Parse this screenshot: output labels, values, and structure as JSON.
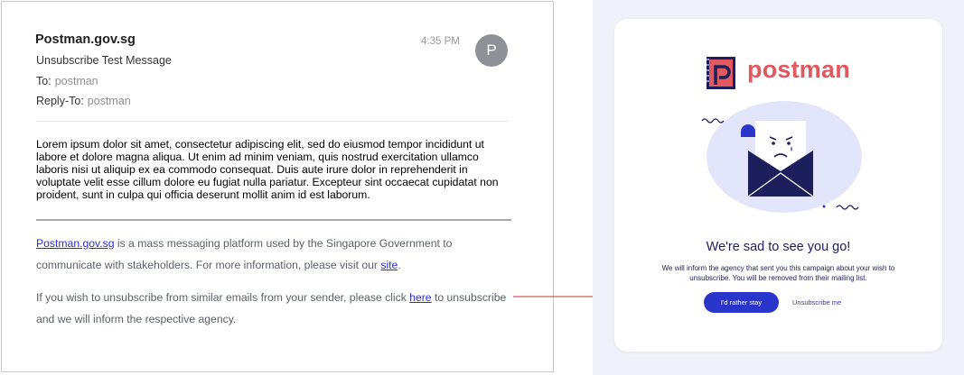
{
  "email": {
    "sender": "Postman.gov.sg",
    "subject": "Unsubscribe Test Message",
    "to_label": "To:",
    "to_value": "postman",
    "reply_to_label": "Reply-To:",
    "reply_to_value": "postman",
    "time": "4:35 PM",
    "avatar_letter": "P",
    "body": "Lorem ipsum dolor sit amet, consectetur adipiscing elit, sed do eiusmod tempor incididunt ut labore et dolore magna aliqua. Ut enim ad minim veniam, quis nostrud exercitation ullamco laboris nisi ut aliquip ex ea commodo consequat. Duis aute irure dolor in reprehenderit in voluptate velit esse cillum dolore eu fugiat nulla pariatur. Excepteur sint occaecat cupidatat non proident, sunt in culpa qui officia deserunt mollit anim id est laborum.",
    "footer": {
      "brand_link": "Postman.gov.sg",
      "line1_rest": " is a mass messaging platform used by the Singapore Government to communicate with stakeholders. For more information, please visit our ",
      "site_link": "site",
      "line1_end": ".",
      "line2_start": "If you wish to unsubscribe from similar emails from your sender, please click ",
      "here_link": "here",
      "line2_end": " to unsubscribe and we will inform the respective agency."
    }
  },
  "arrow_color": "#c0392b",
  "unsubscribe_page": {
    "logo_text": "postman",
    "title": "We're sad to see you go!",
    "message": "We will inform the agency that sent you this campaign about your wish to unsubscribe. You will be removed from their mailing list.",
    "stay_button": "I'd rather stay",
    "unsubscribe_link": "Unsubscribe me",
    "colors": {
      "brand": "#e1585f",
      "primary": "#2a35cc",
      "navy": "#1c1f5c"
    }
  }
}
